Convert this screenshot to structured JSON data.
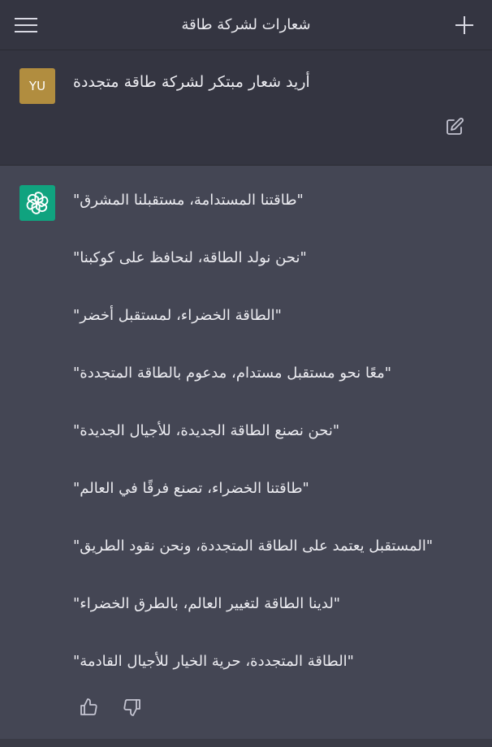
{
  "header": {
    "title": "شعارات لشركة طاقة",
    "menu_icon": "hamburger-menu-icon",
    "new_chat_icon": "plus-icon"
  },
  "user_message": {
    "avatar_initials": "YU",
    "avatar_color": "#b18d3f",
    "text": "أريد شعار مبتكر لشركة طاقة متجددة",
    "edit_icon": "edit-icon"
  },
  "assistant_message": {
    "avatar_icon": "openai-logo-icon",
    "avatar_color": "#10a37f",
    "slogans": [
      "\"طاقتنا المستدامة، مستقبلنا المشرق\"",
      "\"نحن نولد الطاقة، لنحافظ على كوكبنا\"",
      "\"الطاقة الخضراء، لمستقبل أخضر\"",
      "\"معًا نحو مستقبل مستدام، مدعوم بالطاقة المتجددة\"",
      "\"نحن نصنع الطاقة الجديدة، للأجيال الجديدة\"",
      "\"طاقتنا الخضراء، تصنع فرقًا في العالم\"",
      "\"المستقبل يعتمد على الطاقة المتجددة، ونحن نقود الطريق\"",
      "\"لدينا الطاقة لتغيير العالم، بالطرق الخضراء\"",
      "\"الطاقة المتجددة، حرية الخيار للأجيال القادمة\""
    ],
    "feedback": {
      "thumbs_up_icon": "thumbs-up-icon",
      "thumbs_down_icon": "thumbs-down-icon"
    }
  },
  "colors": {
    "header_bg": "#343541",
    "assistant_bg": "#444654",
    "text": "#ececf1",
    "icon": "#c5c5d2"
  }
}
